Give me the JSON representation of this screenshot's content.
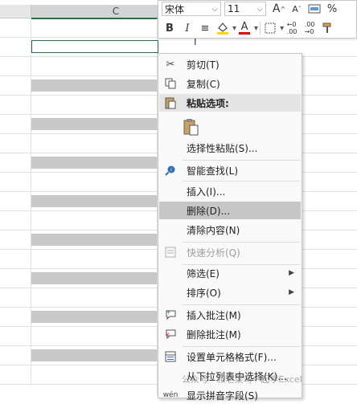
{
  "column_header": {
    "col_c": "C"
  },
  "mini_toolbar": {
    "font_name": "宋体",
    "font_size": "11",
    "grow_font": "A",
    "shrink_font": "A",
    "percent": "%",
    "bold": "B",
    "italic": "I",
    "align": "≡",
    "fill_color": "#ffd700",
    "font_color": "#e00000",
    "font_color_letter": "A"
  },
  "context_menu": {
    "cut": "剪切(T)",
    "copy": "复制(C)",
    "paste_options": "粘贴选项:",
    "paste_special": "选择性粘贴(S)...",
    "smart_lookup": "智能查找(L)",
    "insert": "插入(I)...",
    "delete": "删除(D)...",
    "clear_contents": "清除内容(N)",
    "quick_analysis": "快速分析(Q)",
    "filter": "筛选(E)",
    "sort": "排序(O)",
    "insert_comment": "插入批注(M)",
    "delete_comment": "删除批注(M)",
    "format_cells": "设置单元格格式(F)...",
    "pick_from_list": "从下拉列表中选择(K)...",
    "phonetic": "显示拼音字段(S)",
    "phonetic_icon": "wén"
  },
  "watermark": "公众号 · 和老菜鸟一起学Excel"
}
